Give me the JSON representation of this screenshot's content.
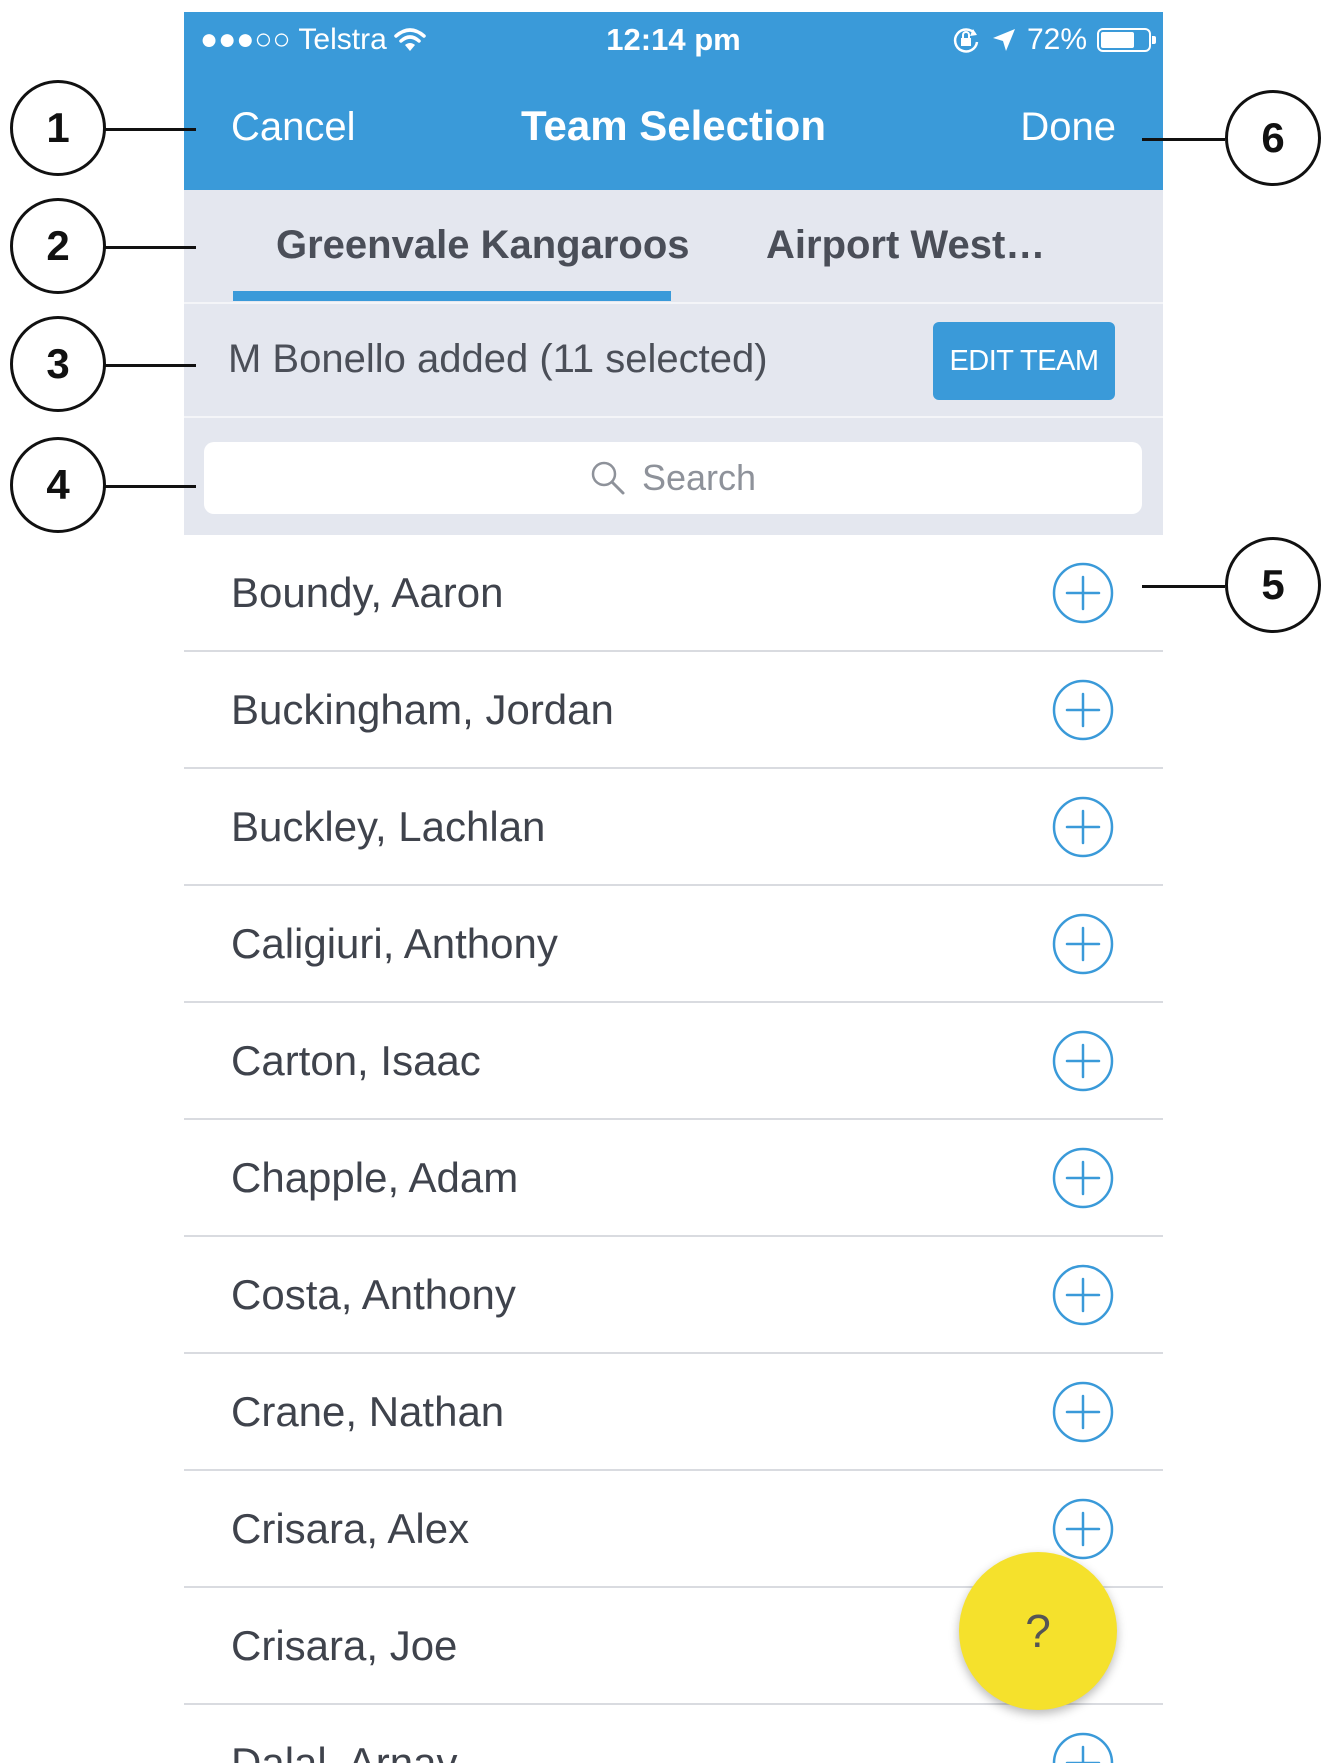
{
  "status_bar": {
    "carrier": "●●●○○ Telstra",
    "time": "12:14 pm",
    "battery": "72%",
    "battery_level": 0.72,
    "icons": [
      "wifi-icon",
      "rotation-lock-icon",
      "location-arrow-icon",
      "battery-icon"
    ]
  },
  "nav": {
    "cancel": "Cancel",
    "title": "Team Selection",
    "done": "Done"
  },
  "tabs": [
    {
      "label": "Greenvale Kangaroos",
      "active": true
    },
    {
      "label": "Airport West…",
      "active": false
    }
  ],
  "info": {
    "text": "M Bonello added (11 selected)",
    "edit_button": "EDIT TEAM"
  },
  "search": {
    "placeholder": "Search"
  },
  "players": [
    "Boundy, Aaron",
    "Buckingham, Jordan",
    "Buckley, Lachlan",
    "Caligiuri, Anthony",
    "Carton, Isaac",
    "Chapple, Adam",
    "Costa, Anthony",
    "Crane, Nathan",
    "Crisara, Alex",
    "Crisara, Joe",
    "Dalal, Arnav"
  ],
  "help": {
    "label": "?"
  },
  "callouts": [
    "1",
    "2",
    "3",
    "4",
    "5",
    "6"
  ],
  "colors": {
    "primary": "#3a9ad9",
    "header_bg": "#e4e7ef",
    "help_fab": "#f5e12c"
  }
}
